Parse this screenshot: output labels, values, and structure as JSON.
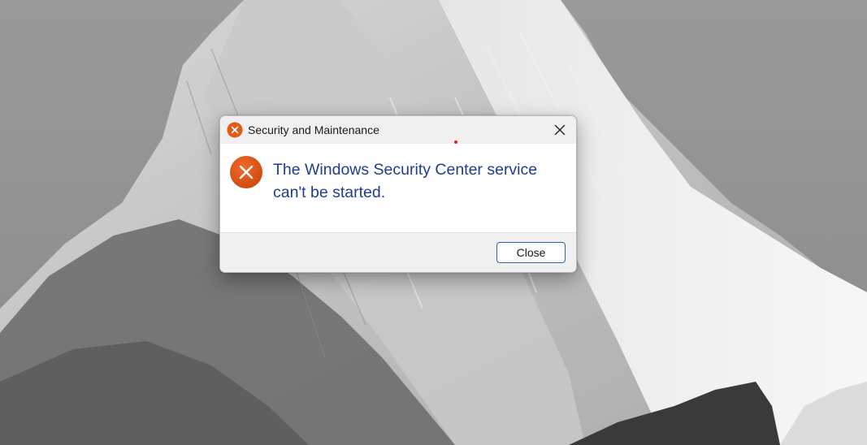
{
  "wallpaper": {
    "name": "snow-mountain-wallpaper"
  },
  "dialog": {
    "title": "Security and Maintenance",
    "title_icon": "error-icon",
    "close_icon": "close-icon",
    "message_icon": "error-icon",
    "message": "The Windows Security Center service can't be started.",
    "close_button_label": "Close",
    "colors": {
      "error": "#e05a1a",
      "message_text": "#1f3c91",
      "button_border": "#2a66b8"
    }
  }
}
